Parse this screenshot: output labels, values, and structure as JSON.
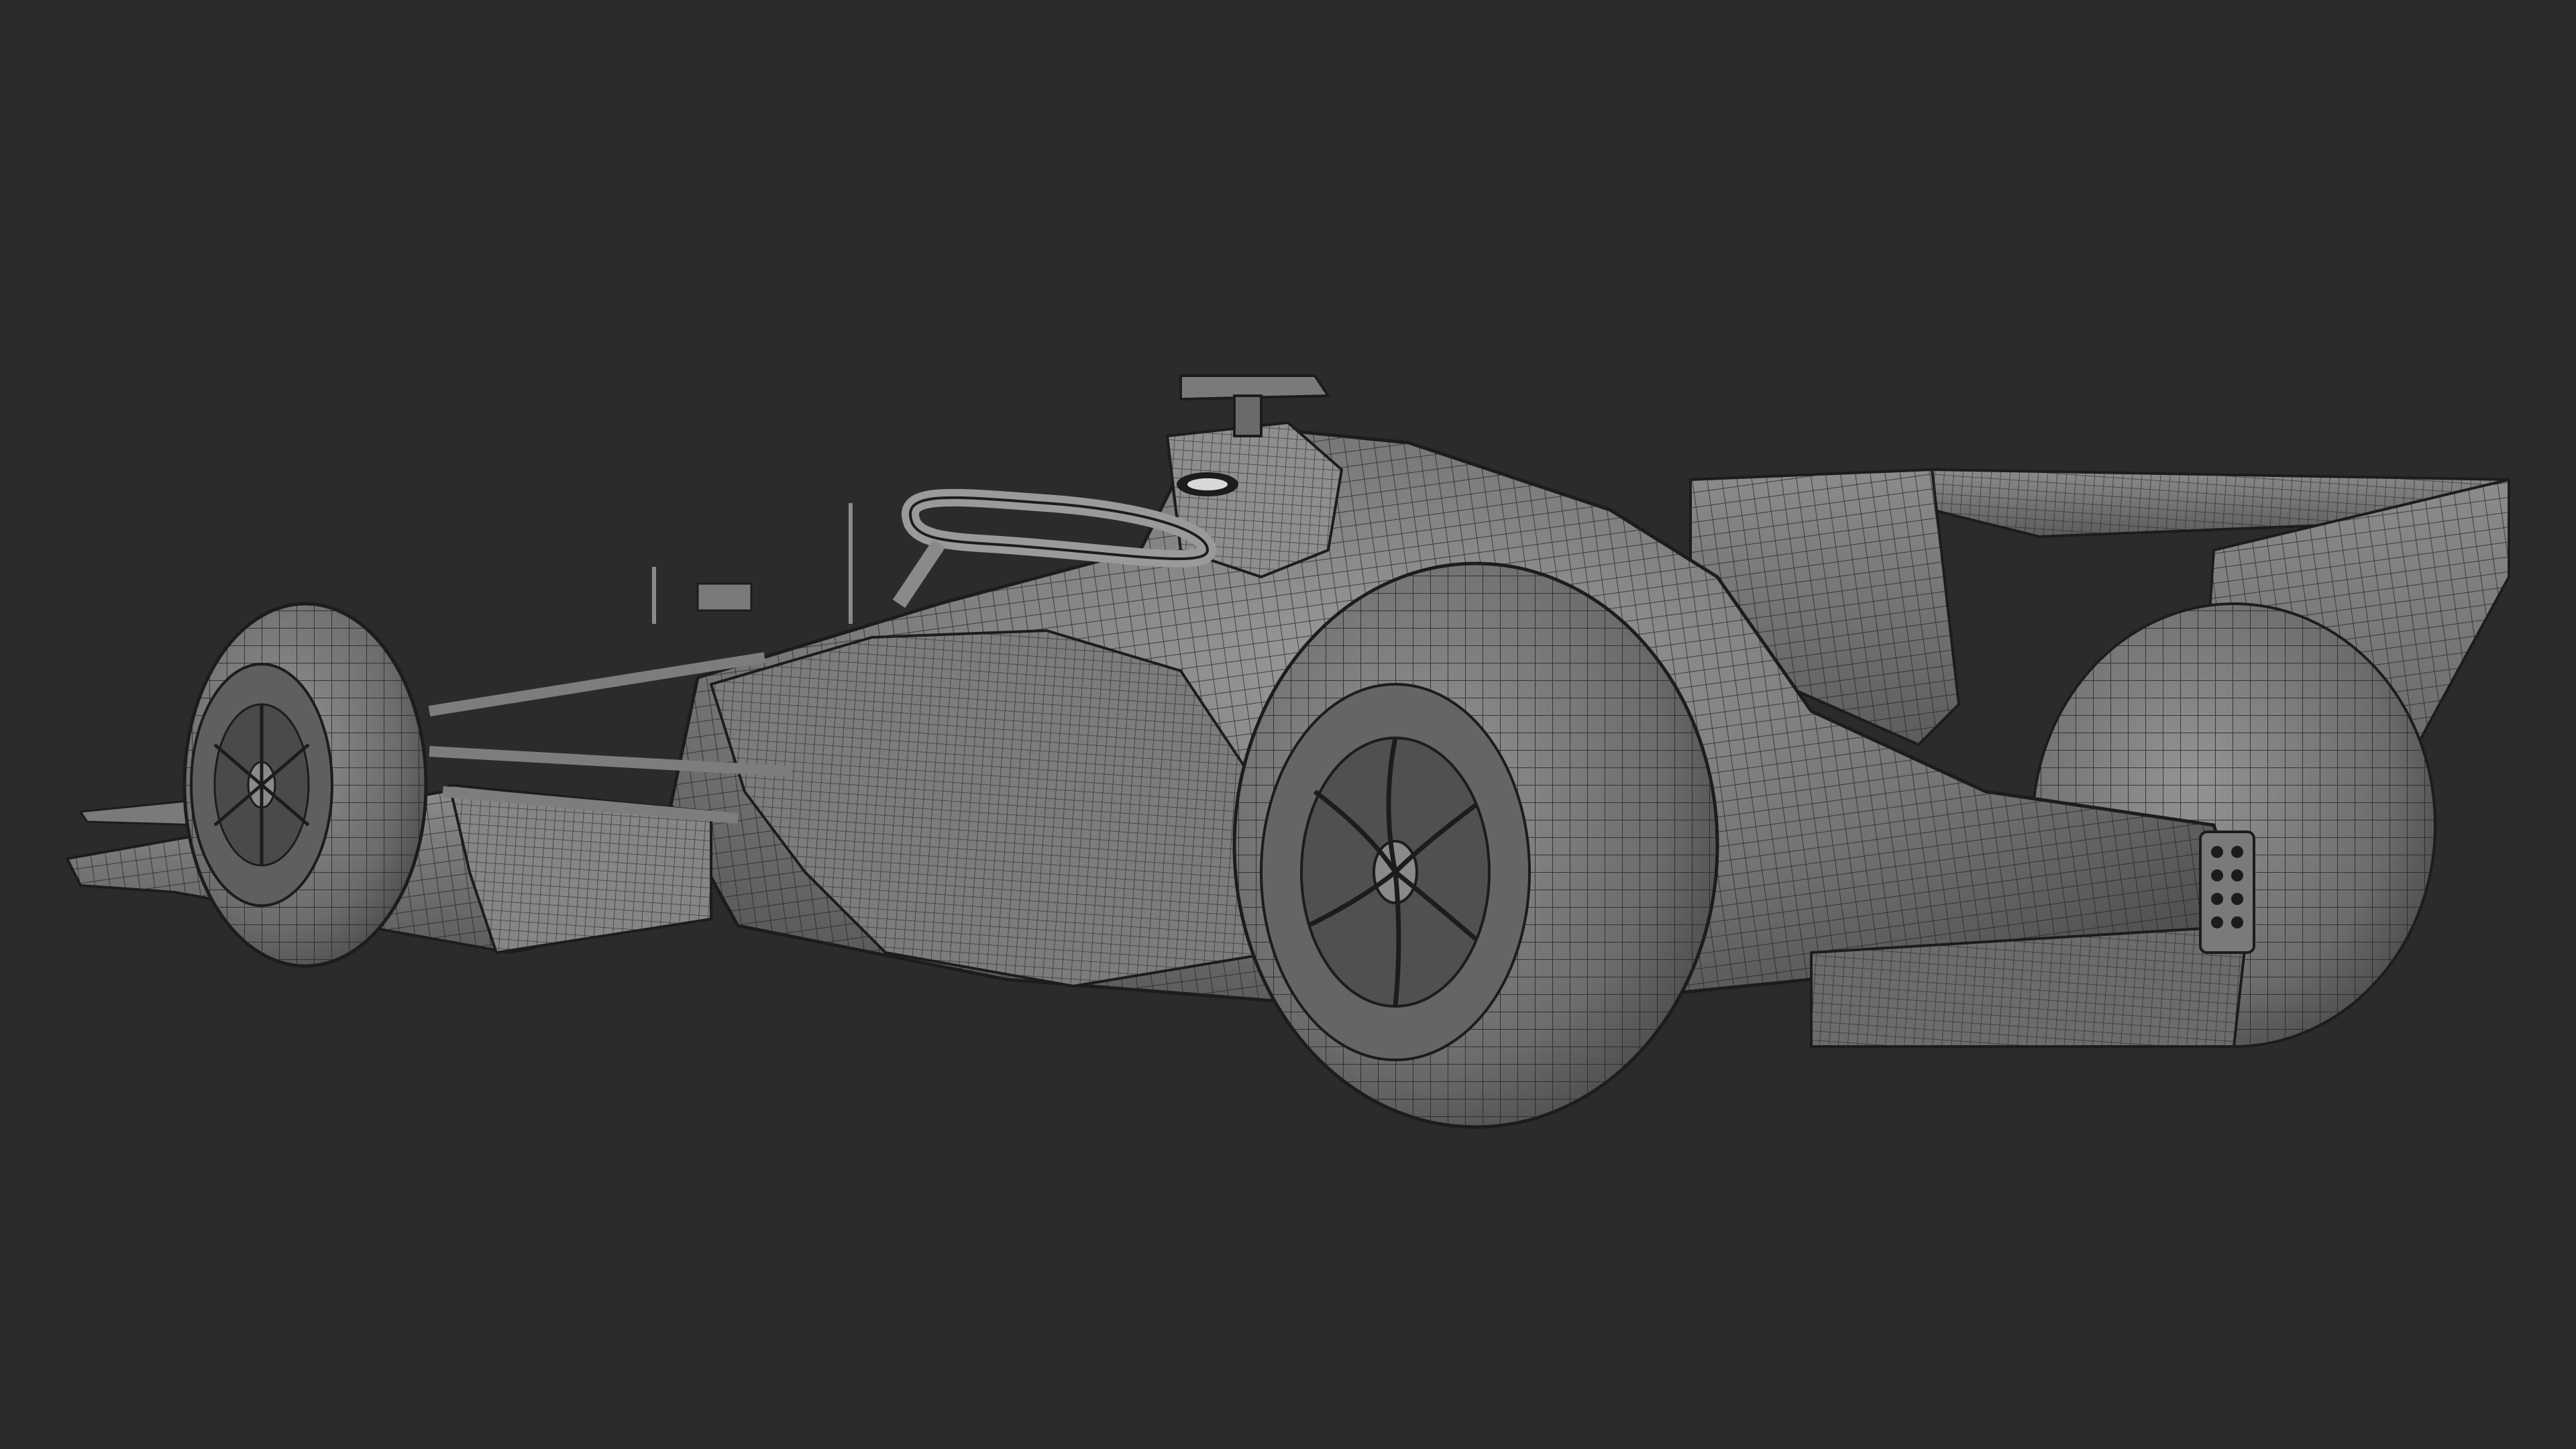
{
  "viewport": {
    "background": "#2b2b2b",
    "mesh_color": "#1f1f1f",
    "surface_color": "#6e6e6e",
    "surface_light": "#8a8a8a",
    "surface_dark": "#4a4a4a"
  },
  "model": {
    "icon": "wireframe-race-car"
  }
}
